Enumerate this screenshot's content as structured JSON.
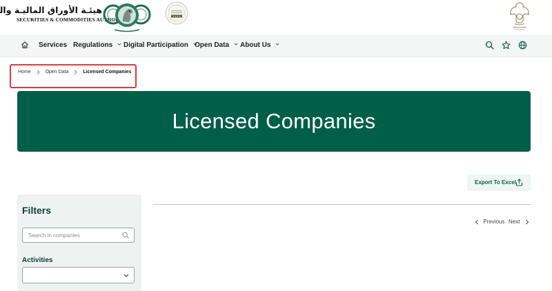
{
  "brand": {
    "name_ar": "هيئـة الأوراق الماليـة والسلـع",
    "name_en": "Securities & Commodities Authority",
    "colors": {
      "primary": "#005f49",
      "accent_red": "#e2363c",
      "panel_bg": "#eef3f2"
    }
  },
  "nav": {
    "home_icon": "home-icon",
    "items": [
      {
        "label": "Services",
        "has_dropdown": false
      },
      {
        "label": "Regulations",
        "has_dropdown": true
      },
      {
        "label": "Digital Participation",
        "has_dropdown": true
      },
      {
        "label": "Open Data",
        "has_dropdown": true
      },
      {
        "label": "About Us",
        "has_dropdown": true
      }
    ],
    "icons": [
      "search-icon",
      "star-icon",
      "globe-icon"
    ]
  },
  "breadcrumb": {
    "items": [
      "Home",
      "Open Data",
      "Licensed Companies"
    ]
  },
  "hero": {
    "title": "Licensed Companies"
  },
  "export": {
    "label": "Export To Excel",
    "icon": "share-icon"
  },
  "pagination": {
    "previous": "Previous",
    "next": "Next"
  },
  "filters": {
    "title": "Filters",
    "search_placeholder": "Search in companies",
    "search_value": "",
    "activities_label": "Activities",
    "activities_selected": ""
  }
}
